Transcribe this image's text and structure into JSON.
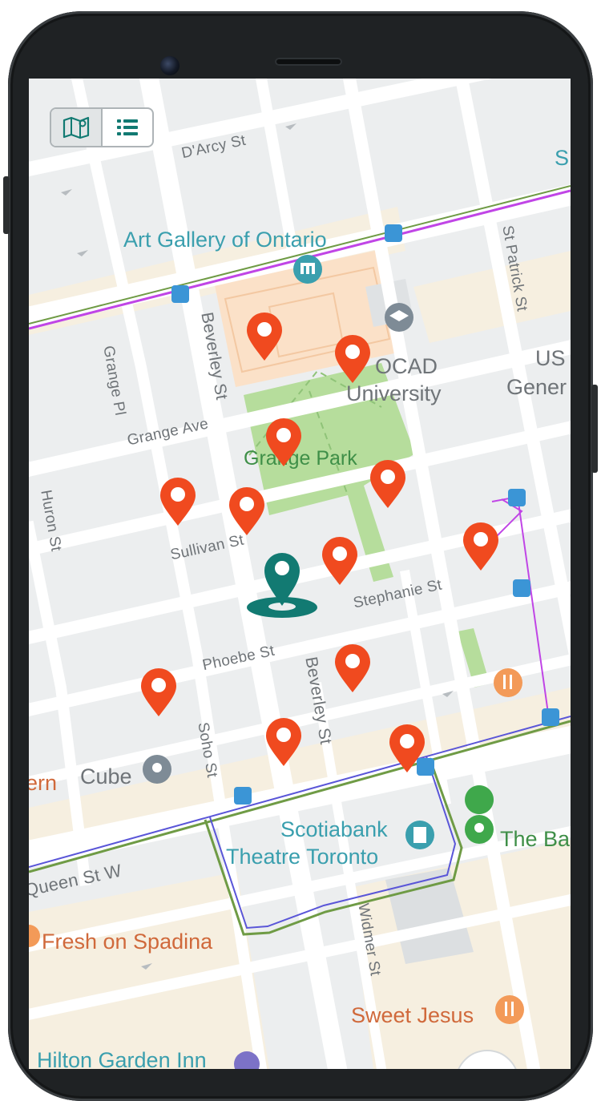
{
  "view_toggle": {
    "map_icon": "map-icon",
    "list_icon": "list-icon",
    "active": "map"
  },
  "colors": {
    "pin": "#f04a1f",
    "current_location": "#127a72",
    "accent": "#127a72",
    "park": "#b6dd9c",
    "subway_line": "#c045e6",
    "streetcar_line": "#6f9b45"
  },
  "streets": {
    "darcy": "D'Arcy St",
    "grange_pl": "Grange Pl",
    "beverley_top": "Beverley St",
    "beverley_bottom": "Beverley St",
    "grange_ave": "Grange Ave",
    "huron": "Huron St",
    "sullivan": "Sullivan St",
    "stephanie": "Stephanie St",
    "phoebe": "Phoebe St",
    "soho": "Soho St",
    "queen": "Queen St W",
    "widmer": "Widmer St",
    "st_patrick": "St Patrick St"
  },
  "places": {
    "ago": "Art Gallery of Ontario",
    "ocad_line1": "OCAD",
    "ocad_line2": "University",
    "grange_park": "Grange Park",
    "us_line1": "US",
    "us_line2": "Gener",
    "cube": "Cube",
    "ern": "ern",
    "scotiabank_line1": "Scotiabank",
    "scotiabank_line2": "Theatre Toronto",
    "the_bay": "The Ba",
    "fresh": "Fresh on Spadina",
    "sweet_jesus": "Sweet Jesus",
    "hilton": "Hilton Garden Inn",
    "edge_s": "S"
  },
  "markers": {
    "count": 12,
    "current_location": "current-location-icon"
  }
}
